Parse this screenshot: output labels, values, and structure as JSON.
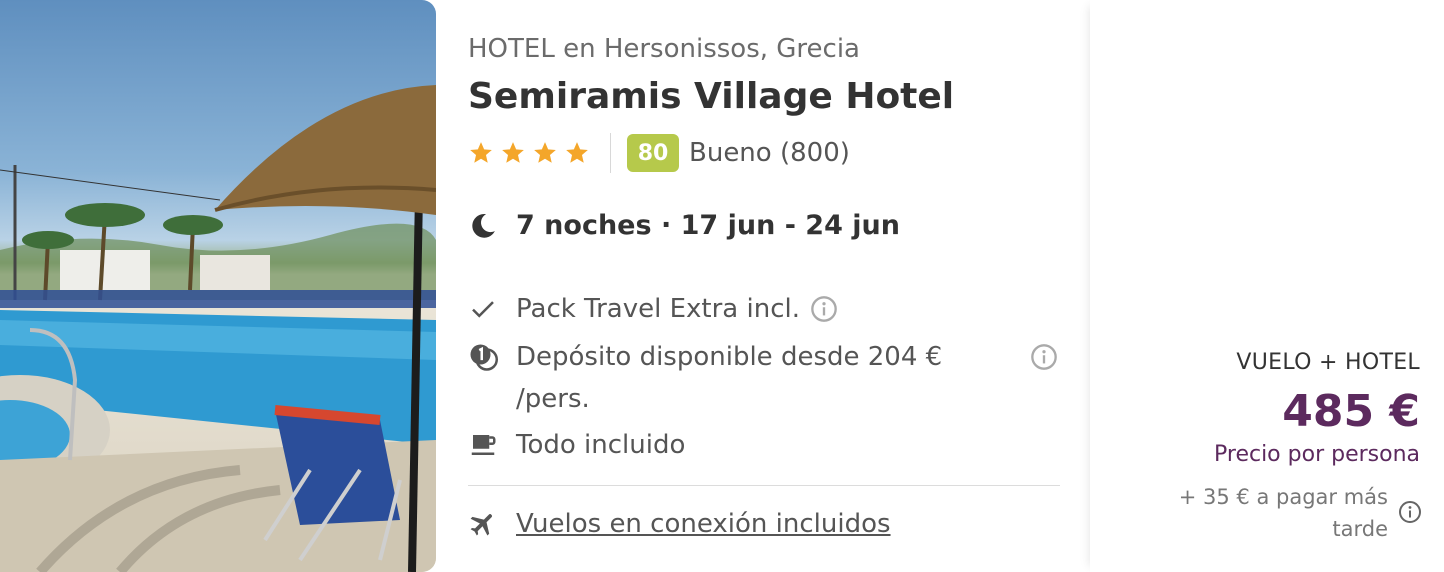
{
  "hotel": {
    "location": "HOTEL en Hersonissos, Grecia",
    "name": "Semiramis Village Hotel",
    "stars": 4,
    "score": "80",
    "score_label": "Bueno (800)"
  },
  "stay": {
    "text": "7 noches · 17 jun - 24 jun"
  },
  "features": {
    "pack": "Pack Travel Extra incl.",
    "deposit": "Depósito disponible desde 204 € /pers.",
    "board": "Todo incluido",
    "flights": "Vuelos en conexión incluidos"
  },
  "price": {
    "label": "VUELO + HOTEL",
    "amount": "485 €",
    "per_person": "Precio por persona",
    "extra": "+ 35 € a pagar más tarde"
  },
  "colors": {
    "star": "#f4a62a",
    "score_bg": "#b6c94b",
    "price": "#5c2a5e"
  },
  "icons": {
    "stay": "moon-icon",
    "pack": "check-icon",
    "deposit": "coin-one-icon",
    "board": "coffee-cup-icon",
    "flights": "airplane-icon",
    "info": "info-icon"
  }
}
